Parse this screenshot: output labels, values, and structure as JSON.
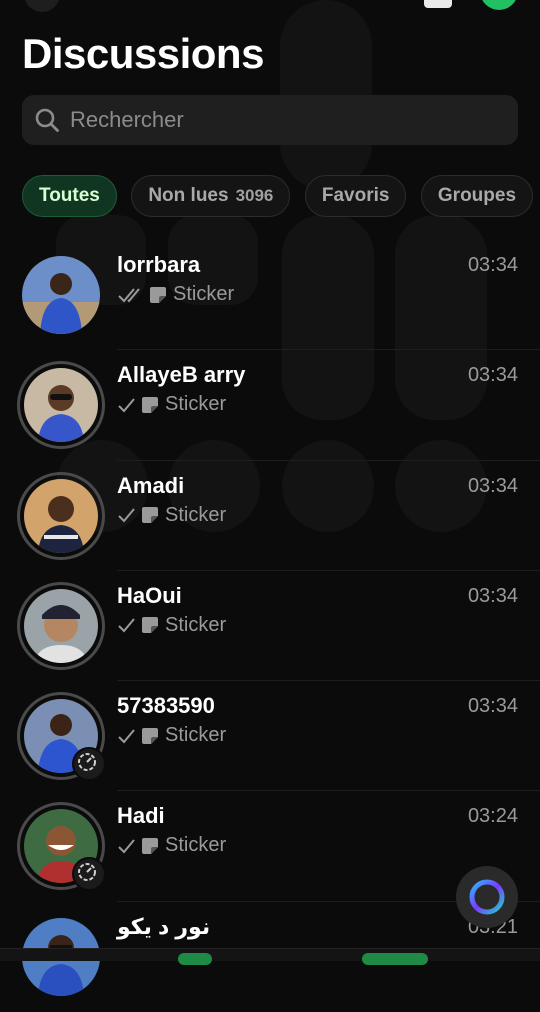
{
  "header": {
    "title": "Discussions"
  },
  "search": {
    "placeholder": "Rechercher"
  },
  "filters": [
    {
      "label": "Toutes",
      "count": "",
      "active": true
    },
    {
      "label": "Non lues",
      "count": "3096",
      "active": false
    },
    {
      "label": "Favoris",
      "count": "",
      "active": false
    },
    {
      "label": "Groupes",
      "count": "",
      "active": false
    }
  ],
  "chats": [
    {
      "name": "lorrbara",
      "time": "03:34",
      "preview": "Sticker",
      "ticks": "double",
      "ring": false,
      "status_badge": false
    },
    {
      "name": "AllayeB arry",
      "time": "03:34",
      "preview": "Sticker",
      "ticks": "single",
      "ring": true,
      "status_badge": false
    },
    {
      "name": "Amadi",
      "time": "03:34",
      "preview": "Sticker",
      "ticks": "single",
      "ring": true,
      "status_badge": false
    },
    {
      "name": "HaOui",
      "time": "03:34",
      "preview": "Sticker",
      "ticks": "single",
      "ring": true,
      "status_badge": false
    },
    {
      "name": "57383590",
      "time": "03:34",
      "preview": "Sticker",
      "ticks": "single",
      "ring": true,
      "status_badge": true
    },
    {
      "name": "Hadi",
      "time": "03:24",
      "preview": "Sticker",
      "ticks": "single",
      "ring": true,
      "status_badge": true
    },
    {
      "name": "نور د يكو",
      "time": "03:21",
      "preview": "",
      "ticks": "none",
      "ring": false,
      "status_badge": false
    }
  ],
  "colors": {
    "accent": "#21c063",
    "active_chip_bg": "#103622",
    "active_chip_text": "#d9fdd3",
    "meta_text": "#9a9a9a"
  },
  "icons": {
    "search": "search-icon",
    "sticker": "sticker-icon",
    "fab": "meta-ai-icon"
  }
}
